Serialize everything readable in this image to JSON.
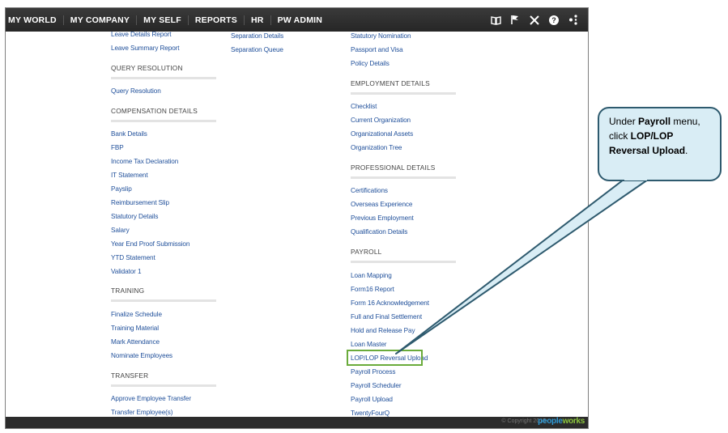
{
  "topnav": {
    "items": [
      "MY WORLD",
      "MY COMPANY",
      "MY SELF",
      "REPORTS",
      "HR",
      "PW ADMIN"
    ],
    "icons": [
      "book-icon",
      "flag-icon",
      "tools-icon",
      "help-icon",
      "share-icon"
    ]
  },
  "col1": {
    "links_top": [
      "Leave Details Report",
      "Leave Summary Report"
    ],
    "query_heading": "QUERY RESOLUTION",
    "query_links": [
      "Query Resolution"
    ],
    "comp_heading": "COMPENSATION DETAILS",
    "comp_links": [
      "Bank Details",
      "FBP",
      "Income Tax Declaration",
      "IT Statement",
      "Payslip",
      "Reimbursement Slip",
      "Statutory Details",
      "Salary",
      "Year End Proof Submission",
      "YTD Statement",
      "Validator 1"
    ],
    "training_heading": "TRAINING",
    "training_links": [
      "Finalize Schedule",
      "Training Material",
      "Mark Attendance",
      "Nominate Employees"
    ],
    "transfer_heading": "TRANSFER",
    "transfer_links": [
      "Approve Employee Transfer",
      "Transfer Employee(s)"
    ]
  },
  "col2": {
    "links": [
      "Separation Details",
      "Separation Queue"
    ]
  },
  "col3": {
    "links_top": [
      "Statutory Nomination",
      "Passport and Visa",
      "Policy Details"
    ],
    "emp_heading": "EMPLOYMENT DETAILS",
    "emp_links": [
      "Checklist",
      "Current Organization",
      "Organizational Assets",
      "Organization Tree"
    ],
    "prof_heading": "PROFESSIONAL DETAILS",
    "prof_links": [
      "Certifications",
      "Overseas Experience",
      "Previous Employment",
      "Qualification Details"
    ],
    "payroll_heading": "PAYROLL",
    "payroll_links": [
      "Loan Mapping",
      "Form16 Report",
      "Form 16 Acknowledgement",
      "Full and Final Settlement",
      "Hold and Release Pay",
      "Loan Master",
      "LOP/LOP Reversal Upload",
      "Payroll Process",
      "Payroll Scheduler",
      "Payroll Upload",
      "TwentyFourQ"
    ]
  },
  "footer": {
    "copyright": "© Copyright 2015",
    "logo_a": "people",
    "logo_b": "works"
  },
  "callout": {
    "t1": "Under ",
    "t2": "Payroll",
    "t3": " menu, click ",
    "t4": "LOP/LOP Reversal Upload",
    "t5": "."
  },
  "colors": {
    "nav_bg": "#262626",
    "link": "#1f4f9a",
    "highlight": "#6aab3b",
    "callout_fill": "#d9edf5",
    "callout_border": "#2e5a6e"
  }
}
